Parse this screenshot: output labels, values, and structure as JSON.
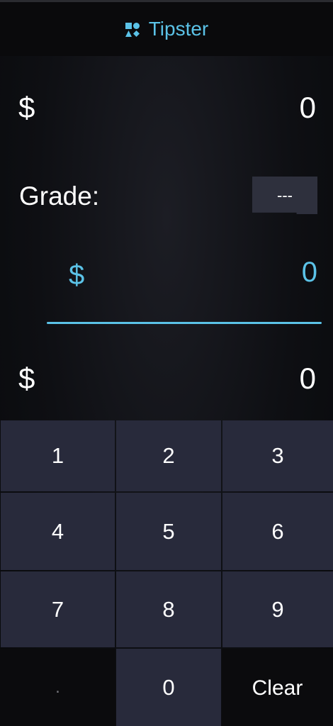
{
  "app": {
    "title": "Tipster",
    "icon": "shapes-icon",
    "accent": "#5bc2e7"
  },
  "bill": {
    "currency": "$",
    "value": "0"
  },
  "grade": {
    "label": "Grade:",
    "selected": "---"
  },
  "tip": {
    "currency": "$",
    "value": "0"
  },
  "total": {
    "currency": "$",
    "value": "0"
  },
  "keypad": {
    "keys": [
      "1",
      "2",
      "3",
      "4",
      "5",
      "6",
      "7",
      "8",
      "9",
      ".",
      "0",
      "Clear"
    ]
  }
}
